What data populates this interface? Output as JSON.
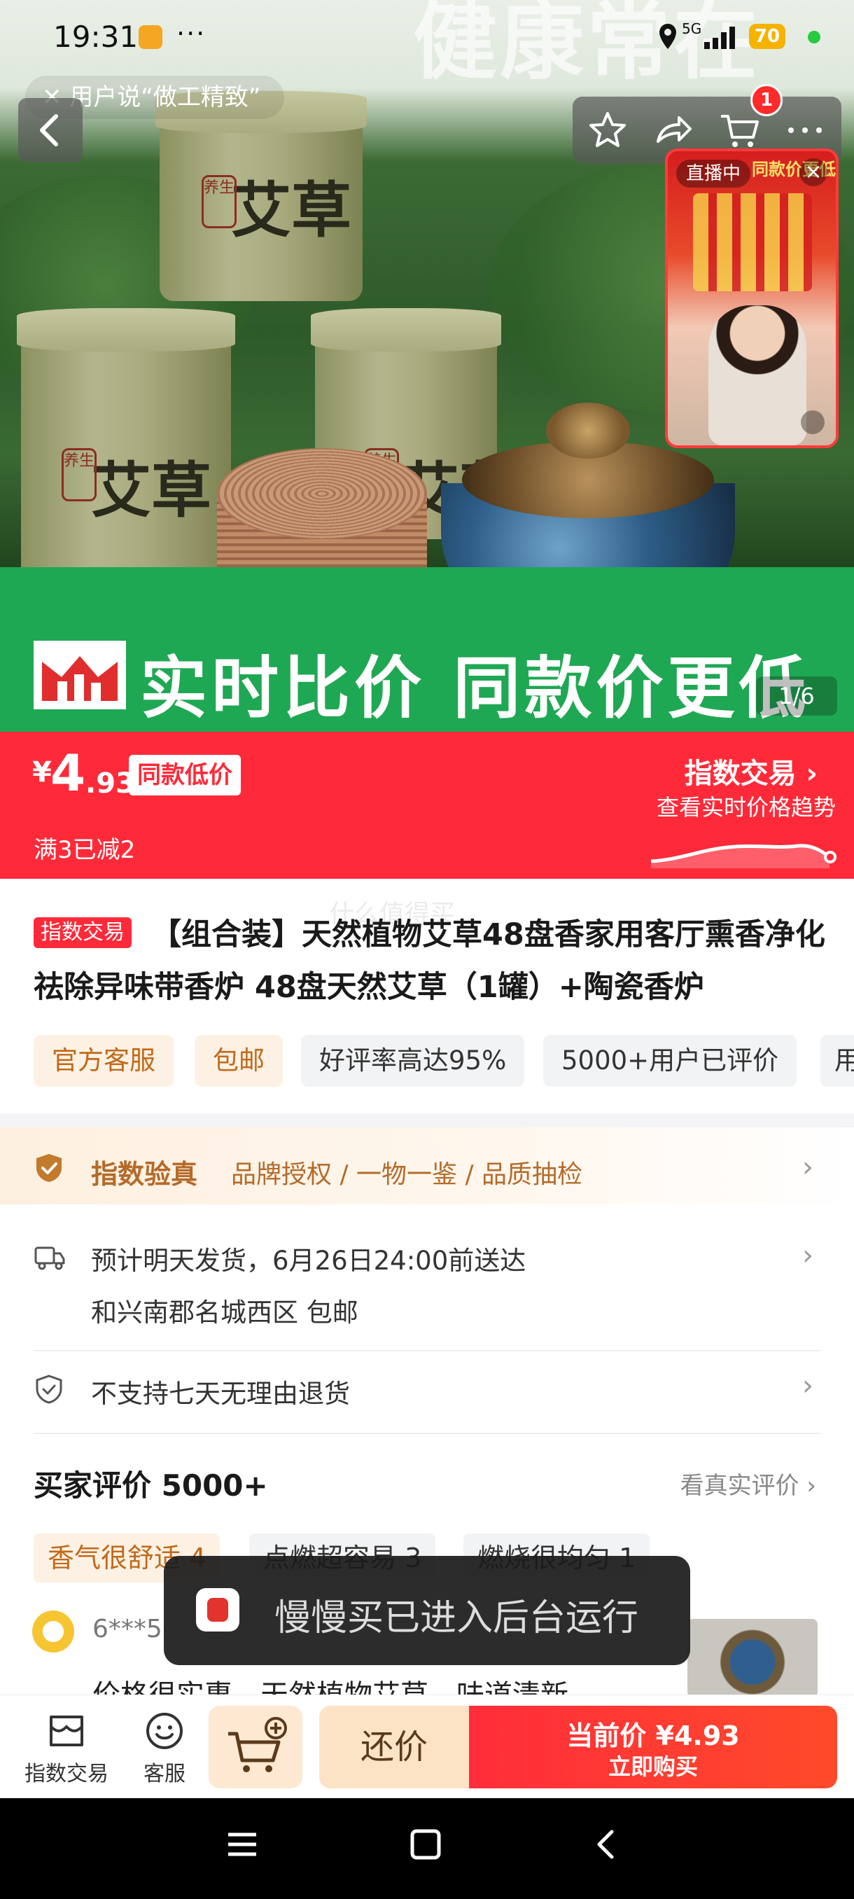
{
  "status_bar": {
    "time": "19:31",
    "dots": "···",
    "network": "5G",
    "battery": "70"
  },
  "top_hint": "用户说“做工精致”",
  "hero": {
    "banner_text": "健康常在",
    "can_label": "艾草",
    "can_seal": "养生",
    "strip_text": "实时比价 同款价更低",
    "counter": "1/6",
    "cart_badge": "1"
  },
  "live": {
    "badge": "直播中",
    "close": "×",
    "headline": "同款价更低"
  },
  "price": {
    "currency": "¥",
    "integer": "4",
    "decimal": ".93",
    "tag": "同款低价",
    "promo": "满3已减2",
    "index_title": "指数交易",
    "index_sub": "查看实时价格趋势"
  },
  "product": {
    "badge": "指数交易",
    "title": "【组合装】天然植物艾草48盘香家用客厅熏香净化祛除异味带香炉 48盘天然艾草（1罐）+陶瓷香炉",
    "watermark": "什么值得买",
    "chips": [
      "官方客服",
      "包邮",
      "好评率高达95%",
      "5000+用户已评价",
      "用"
    ]
  },
  "verify": {
    "title": "指数验真",
    "desc": "品牌授权 / 一物一鉴 / 品质抽检"
  },
  "shipping": {
    "line1": "预计明天发货，6月26日24:00前送达",
    "line2": "和兴南郡名城西区  包邮"
  },
  "returns": {
    "text": "不支持七天无理由退货"
  },
  "reviews": {
    "title": "买家评价 5000+",
    "link": "看真实评价",
    "tags": [
      "香气很舒适 4",
      "点燃超容易 3",
      "燃烧很均匀 1"
    ],
    "user": "6***5",
    "text": "价格很实惠，天然植物艾草，味道清新"
  },
  "toast": {
    "text": "慢慢买已进入后台运行"
  },
  "bottom": {
    "index_label": "指数交易",
    "service_label": "客服",
    "bargain": "还价",
    "buy_line1": "当前价 ¥4.93",
    "buy_line2": "立即购买"
  },
  "colors": {
    "accent_red": "#ff2a39",
    "green_strip": "#1fa853",
    "orange_text": "#b46b2a"
  }
}
